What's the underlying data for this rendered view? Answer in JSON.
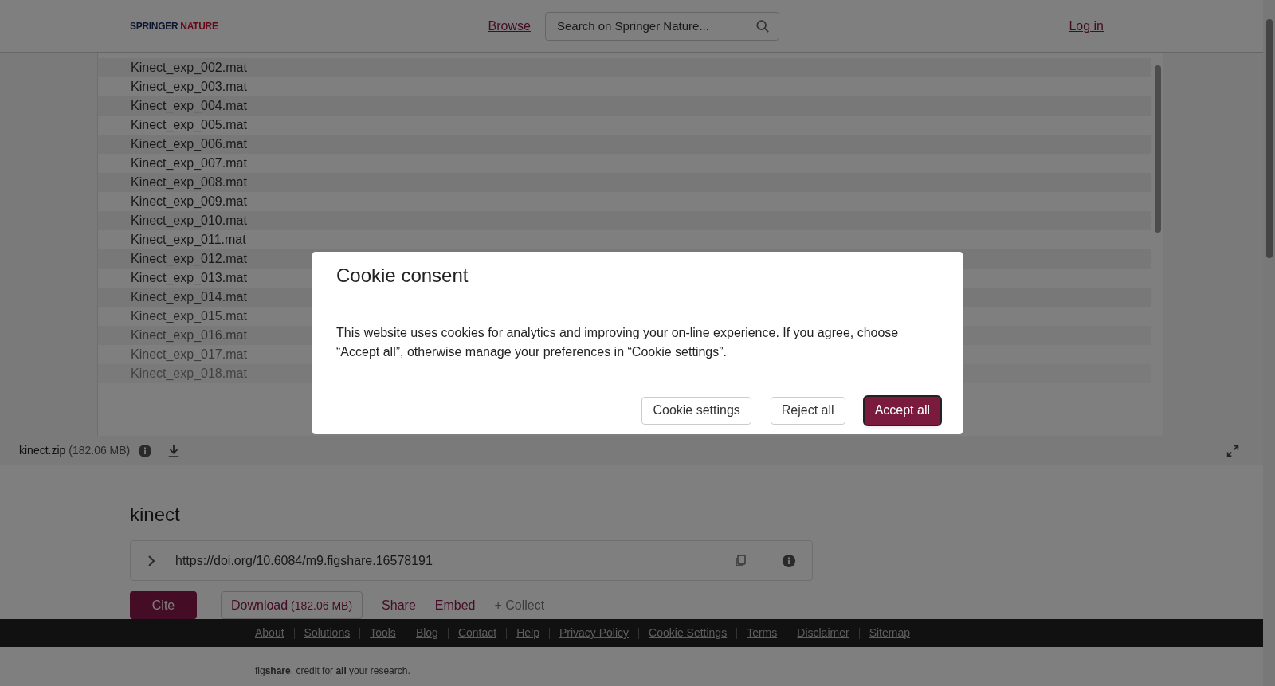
{
  "header": {
    "logo": {
      "first": "SPRINGER",
      "second": "NATURE"
    },
    "browse": "Browse",
    "search": {
      "placeholder": "Search on Springer Nature..."
    },
    "login": "Log in"
  },
  "files": [
    "Kinect_exp_002.mat",
    "Kinect_exp_003.mat",
    "Kinect_exp_004.mat",
    "Kinect_exp_005.mat",
    "Kinect_exp_006.mat",
    "Kinect_exp_007.mat",
    "Kinect_exp_008.mat",
    "Kinect_exp_009.mat",
    "Kinect_exp_010.mat",
    "Kinect_exp_011.mat",
    "Kinect_exp_012.mat",
    "Kinect_exp_013.mat",
    "Kinect_exp_014.mat",
    "Kinect_exp_015.mat",
    "Kinect_exp_016.mat",
    "Kinect_exp_017.mat",
    "Kinect_exp_018.mat"
  ],
  "file_bar": {
    "name": "kinect.zip",
    "size": "(182.06 MB)"
  },
  "item": {
    "title": "kinect",
    "doi": "https://doi.org/10.6084/m9.figshare.16578191"
  },
  "actions": [
    {
      "kind": "primary",
      "label": "Cite"
    },
    {
      "kind": "outline",
      "label": "Download",
      "extra": "(182.06 MB)"
    },
    {
      "kind": "link",
      "label": "Share"
    },
    {
      "kind": "link",
      "label": "Embed"
    },
    {
      "kind": "muted",
      "label": "+ Collect"
    }
  ],
  "footer": {
    "links": [
      "About",
      "Solutions",
      "Tools",
      "Blog",
      "Contact",
      "Help",
      "Privacy Policy",
      "Cookie Settings",
      "Terms",
      "Disclaimer",
      "Sitemap"
    ],
    "tagline": "fig**share**. credit for **all** your research."
  },
  "cookie_dialog": {
    "title": "Cookie consent",
    "text": "This website uses cookies for analytics and improving your on-line experience. If you agree, choose “Accept all”, otherwise manage your preferences in “Cookie settings”.",
    "buttons": [
      {
        "kind": "secondary",
        "label": "Cookie settings",
        "focused": false
      },
      {
        "kind": "secondary",
        "label": "Reject all",
        "focused": false
      },
      {
        "kind": "primary",
        "label": "Accept all",
        "focused": true
      }
    ]
  }
}
